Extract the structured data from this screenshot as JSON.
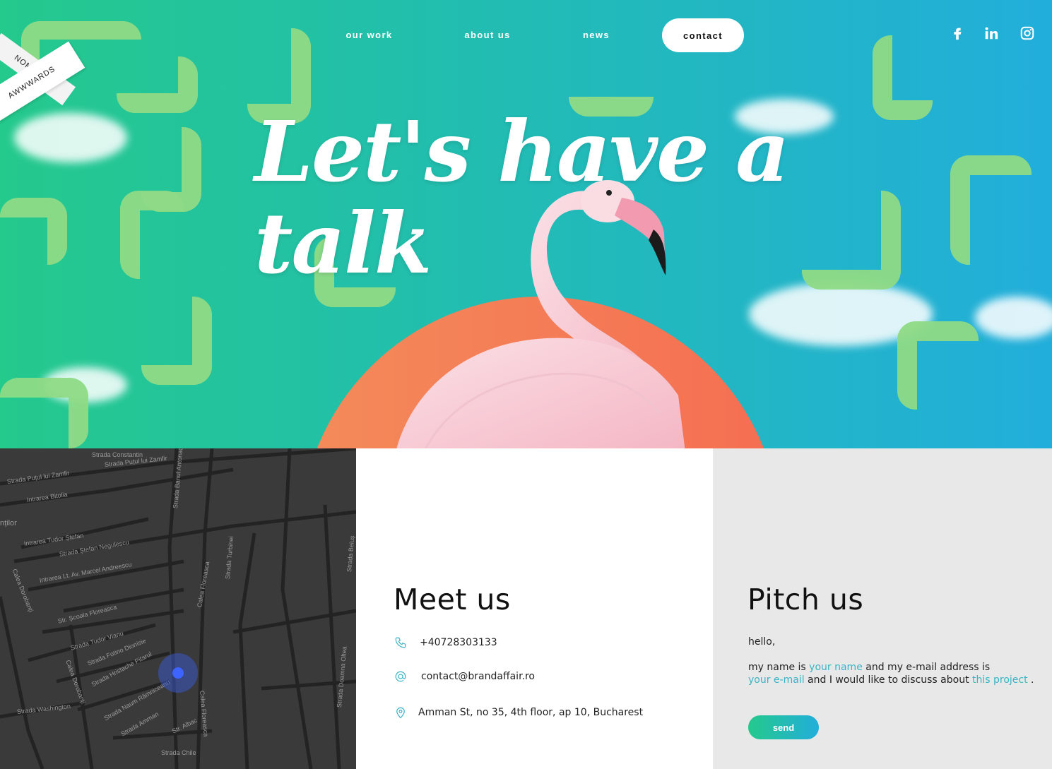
{
  "nav": {
    "items": [
      {
        "label": "our work"
      },
      {
        "label": "about us"
      },
      {
        "label": "news"
      },
      {
        "label": "contact"
      }
    ]
  },
  "social": [
    "facebook-icon",
    "linkedin-icon",
    "instagram-icon"
  ],
  "award": {
    "line1": "NOMINEE",
    "line2": "AWWWARDS"
  },
  "hero": {
    "headline": "Let's have a talk"
  },
  "map": {
    "labels": [
      "Strada Constantin",
      "Strada Puțul lui Zamfir",
      "Strada Puțul lui Zamfir",
      "Intrarea Bitolia",
      "Intrarea Tudor Ștefan",
      "Strada Ștefan Negulescu",
      "Intrarea Lt. Av. Marcel Andreescu",
      "Calea Dorobanți",
      "Str. Școala Floreasca",
      "Strada Tudor Vianu",
      "Strada Fotino Dionisie",
      "Strada Hristache Pitarul",
      "Calea Floreasca",
      "Strada Turbinei",
      "Strada Banul Antonache",
      "Calea Dorobanți",
      "Strada Washington",
      "Strada Naum Râmniceanu",
      "Strada Amman",
      "Str. Albac",
      "Strada Chile",
      "Strada Doamna Oltea",
      "Calea Floreasca",
      "Strada Beiuș",
      "nților"
    ]
  },
  "meet": {
    "title": "Meet us",
    "phone": "+40728303133",
    "email": "contact@brandaffair.ro",
    "address": "Amman St, no 35, 4th floor, ap 10, Bucharest"
  },
  "pitch": {
    "title": "Pitch us",
    "greeting": "hello,",
    "line1_a": "my name is ",
    "name_placeholder": "your name",
    "line1_b": " and my e-mail address is",
    "email_placeholder": "your e-mail",
    "line2_b": " and I would like to discuss about ",
    "project_placeholder": "this project",
    "line2_end": " .",
    "send_label": "send"
  },
  "colors": {
    "hero_start": "#24c98c",
    "hero_end": "#22aedb",
    "sun": "#f56e52",
    "accent": "#3ab4c4"
  }
}
